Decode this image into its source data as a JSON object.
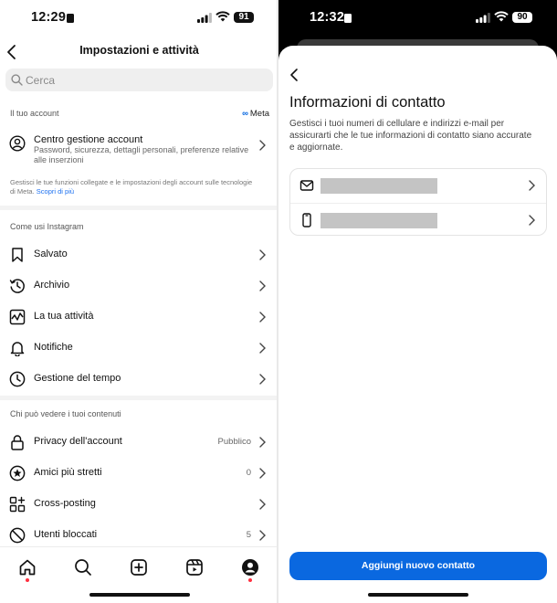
{
  "colors": {
    "accent": "#0a68e0",
    "notification_dot": "#ff3040",
    "meta_blue": "#0064e0"
  },
  "left": {
    "status": {
      "time": "12:29",
      "battery": "91"
    },
    "header": {
      "title": "Impostazioni e attività",
      "back_icon": "chevron-left-icon"
    },
    "search": {
      "placeholder": "Cerca",
      "icon": "search-icon"
    },
    "account_section": {
      "heading": "Il tuo account",
      "brand": "Meta",
      "item": {
        "title": "Centro gestione account",
        "subtitle": "Password, sicurezza, dettagli personali, preferenze relative alle inserzioni",
        "icon": "user-circle-icon"
      },
      "note": "Gestisci le tue funzioni collegate e le impostazioni degli account sulle tecnologie di Meta.",
      "note_link": "Scopri di più"
    },
    "how_you_use": {
      "heading": "Come usi Instagram",
      "items": [
        {
          "label": "Salvato",
          "icon": "bookmark-icon"
        },
        {
          "label": "Archivio",
          "icon": "archive-history-icon"
        },
        {
          "label": "La tua attività",
          "icon": "activity-chart-icon"
        },
        {
          "label": "Notifiche",
          "icon": "bell-icon"
        },
        {
          "label": "Gestione del tempo",
          "icon": "clock-icon"
        }
      ]
    },
    "who_can_see": {
      "heading": "Chi può vedere i tuoi contenuti",
      "items": [
        {
          "label": "Privacy dell'account",
          "value": "Pubblico",
          "icon": "lock-icon"
        },
        {
          "label": "Amici più stretti",
          "value": "0",
          "icon": "star-circle-icon"
        },
        {
          "label": "Cross-posting",
          "value": "",
          "icon": "grid-plus-icon"
        },
        {
          "label": "Utenti bloccati",
          "value": "5",
          "icon": "block-icon"
        }
      ]
    },
    "tabbar": [
      "home-icon",
      "search-icon",
      "create-icon",
      "reels-icon",
      "profile-icon"
    ]
  },
  "right": {
    "status": {
      "time": "12:32",
      "battery": "90"
    },
    "title": "Informazioni di contatto",
    "description": "Gestisci i tuoi numeri di cellulare e indirizzi e-mail per assicurarti che le tue informazioni di contatto siano accurate e aggiornate.",
    "contacts": [
      {
        "icon": "mail-icon",
        "value_redacted": true
      },
      {
        "icon": "phone-icon",
        "value_redacted": true
      }
    ],
    "button": "Aggiungi nuovo contatto"
  }
}
